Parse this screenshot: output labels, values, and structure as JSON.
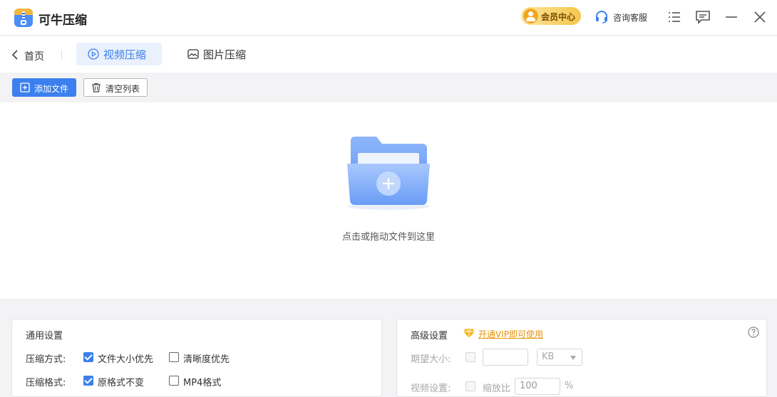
{
  "app": {
    "title": "可牛压缩",
    "vip_center": "会员中心",
    "support": "咨询客服"
  },
  "nav": {
    "back": "首页",
    "tabs": [
      {
        "label": "视频压缩",
        "active": true
      },
      {
        "label": "图片压缩",
        "active": false
      }
    ]
  },
  "toolbar": {
    "add_file": "添加文件",
    "clear_list": "清空列表"
  },
  "dropzone": {
    "hint": "点击或拖动文件到这里"
  },
  "general": {
    "title": "通用设置",
    "mode_label": "压缩方式:",
    "mode_options": [
      {
        "label": "文件大小优先",
        "checked": true
      },
      {
        "label": "清晰度优先",
        "checked": false
      }
    ],
    "format_label": "压缩格式:",
    "format_options": [
      {
        "label": "原格式不变",
        "checked": true
      },
      {
        "label": "MP4格式",
        "checked": false
      }
    ]
  },
  "advanced": {
    "title": "高级设置",
    "vip_link": "开通VIP即可使用",
    "size_label": "期望大小:",
    "size_value": "",
    "unit": "KB",
    "video_label": "视频设置:",
    "scale_label": "缩放比",
    "scale_value": "100",
    "percent": "%"
  },
  "colors": {
    "accent": "#3b80ee",
    "vip_gold": "#f5c64e",
    "link_orange": "#e8940c"
  }
}
